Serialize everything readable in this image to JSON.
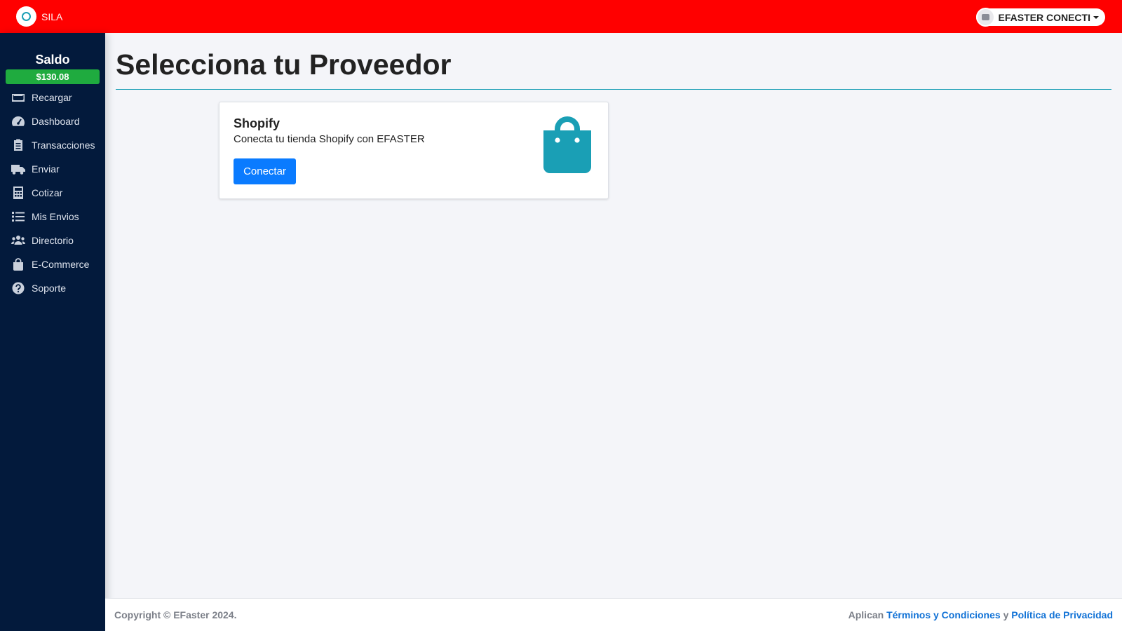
{
  "header": {
    "brand_name": "SILA",
    "user_name": "EFASTER CONECTI",
    "bg_color": "#ff0000"
  },
  "sidebar": {
    "saldo_label": "Saldo",
    "saldo_value": "$130.08",
    "items": [
      {
        "label": "Recargar",
        "icon": "money-bill-icon"
      },
      {
        "label": "Dashboard",
        "icon": "gauge-icon"
      },
      {
        "label": "Transacciones",
        "icon": "clipboard-icon"
      },
      {
        "label": "Enviar",
        "icon": "truck-icon"
      },
      {
        "label": "Cotizar",
        "icon": "calculator-icon"
      },
      {
        "label": "Mis Envios",
        "icon": "list-icon"
      },
      {
        "label": "Directorio",
        "icon": "users-icon"
      },
      {
        "label": "E-Commerce",
        "icon": "shopping-bag-icon"
      },
      {
        "label": "Soporte",
        "icon": "question-circle-icon"
      }
    ]
  },
  "main": {
    "title": "Selecciona tu Proveedor",
    "card": {
      "title": "Shopify",
      "description": "Conecta tu tienda Shopify con EFASTER",
      "button_label": "Conectar",
      "icon": "shopping-bag-icon",
      "icon_color": "#1a9fb5"
    }
  },
  "footer": {
    "copyright": "Copyright © EFaster 2024.",
    "aplican": "Aplican",
    "terms": "Términos y Condiciones",
    "y": "y",
    "privacy": "Política de Privacidad"
  }
}
